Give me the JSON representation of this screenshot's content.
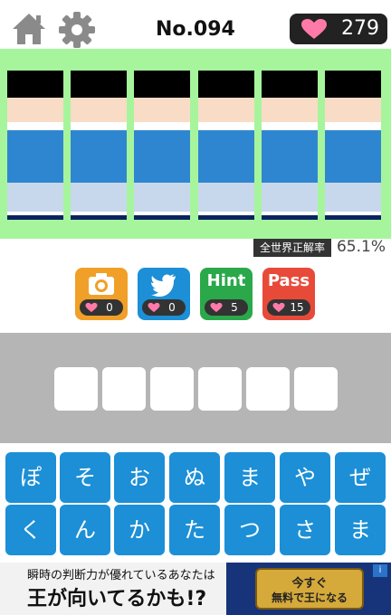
{
  "header": {
    "home_icon": "home-icon",
    "settings_icon": "gear-icon",
    "level": "No.094",
    "hearts": "279"
  },
  "puzzle": {
    "tile_count": 6,
    "colors": {
      "background": "#a6f59d",
      "hair": "#000000",
      "skin": "#f8dcc5",
      "shirt": "#2f86d0",
      "light": "#c8d8ec",
      "navy": "#0b2460"
    }
  },
  "rate": {
    "label": "全世界正解率",
    "value": "65.1%"
  },
  "actions": [
    {
      "label": "",
      "icon": "camera-icon",
      "count": "0",
      "color": "#f0a028"
    },
    {
      "label": "",
      "icon": "twitter-bird-icon",
      "count": "0",
      "color": "#1c8fd6"
    },
    {
      "label": "Hint",
      "icon": "",
      "count": "5",
      "color": "#2aa84a"
    },
    {
      "label": "Pass",
      "icon": "",
      "count": "15",
      "color": "#e84a3a"
    }
  ],
  "answer_slots": 6,
  "keyboard": {
    "row1": [
      "ぽ",
      "そ",
      "お",
      "ぬ",
      "ま",
      "や",
      "ぜ"
    ],
    "row2": [
      "く",
      "ん",
      "か",
      "た",
      "つ",
      "さ",
      "ま"
    ]
  },
  "ad": {
    "line1": "瞬時の判断力が優れているあなたは",
    "line2": "王が向いてるかも!?",
    "cta_line1": "今すぐ",
    "cta_line2": "無料で王になる",
    "info": "i"
  }
}
